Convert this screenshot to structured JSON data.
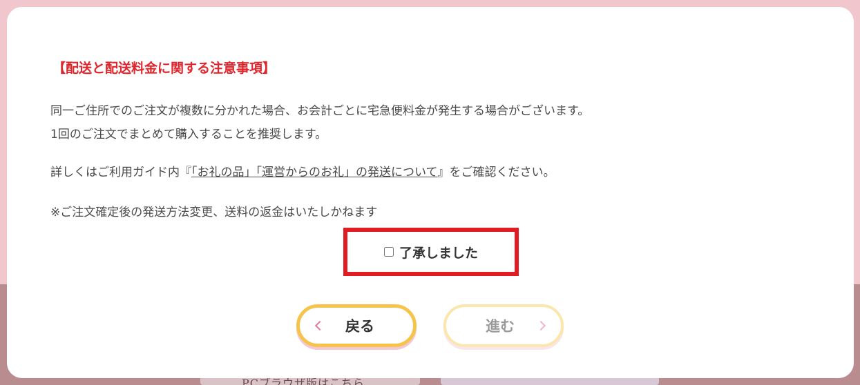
{
  "background": {
    "card_left_text": "PCブラウザ版はこちら"
  },
  "notice": {
    "title": "【配送と配送料金に関する注意事項】",
    "line1": "同一ご住所でのご注文が複数に分かれた場合、お会計ごとに宅急便料金が発生する場合がございます。",
    "line2": "1回のご注文でまとめて購入することを推奨します。",
    "guide_prefix": "詳しくはご利用ガイド内『",
    "guide_link": "「お礼の品」「運営からのお礼」の発送について",
    "guide_suffix": "』をご確認ください。",
    "note": "※ご注文確定後の発送方法変更、送料の返金はいたしかねます"
  },
  "confirm": {
    "label": "了承しました",
    "checked": false
  },
  "buttons": {
    "back_label": "戻る",
    "next_label": "進む"
  },
  "colors": {
    "accent_red": "#e31b23",
    "title_red": "#e0262c",
    "back_border": "#f6c44a",
    "next_border": "#fbe6ab",
    "page_pink": "#f1c6cc"
  },
  "icons": {
    "back": "chevron-left-icon",
    "next": "chevron-right-icon"
  }
}
